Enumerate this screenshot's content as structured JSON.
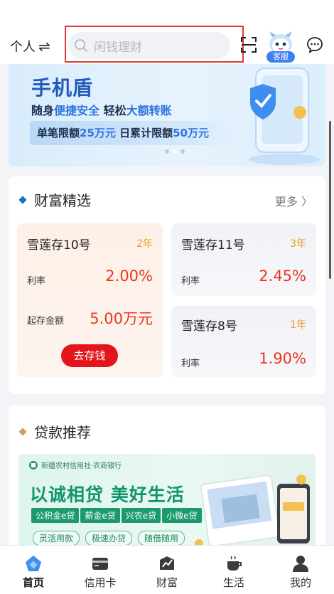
{
  "header": {
    "persona_label": "个人",
    "swap_glyph": "⇌",
    "search_placeholder": "闲钱理财",
    "service_badge": "客服"
  },
  "banner": {
    "title": "手机盾",
    "subtitle_part1": "随身",
    "subtitle_hl1": "便捷安全",
    "subtitle_part2": " 轻松",
    "subtitle_hl2": "大额转账",
    "limit_part1": "单笔限额",
    "limit_num1": "25万元",
    "limit_part2": " 日累计限额",
    "limit_num2": "50万元"
  },
  "wealth": {
    "title": "财富精选",
    "more": "更多 〉",
    "accent": "#1a6fc9",
    "featured": {
      "name": "雪莲存10号",
      "term": "2年",
      "rate_label": "利率",
      "rate": "2.00%",
      "min_label": "起存金额",
      "min_amount": "5.00万元",
      "cta": "去存钱"
    },
    "products": [
      {
        "name": "雪莲存11号",
        "term": "3年",
        "rate_label": "利率",
        "rate": "2.45%"
      },
      {
        "name": "雪莲存8号",
        "term": "1年",
        "rate_label": "利率",
        "rate": "1.90%"
      }
    ]
  },
  "loans": {
    "title": "贷款推荐",
    "accent": "#c9a25a",
    "banner_brand": "新疆农村信用社·农商银行",
    "banner_title": "以诚相贷 美好生活",
    "products": [
      "公积金e贷",
      "薪金e贷",
      "兴农e贷",
      "小微e贷"
    ],
    "tags": [
      "灵活用款",
      "极速办贷",
      "随借随用"
    ]
  },
  "tabs": [
    {
      "label": "首页",
      "icon": "home-icon",
      "active": true
    },
    {
      "label": "信用卡",
      "icon": "credit-card-icon",
      "active": false
    },
    {
      "label": "财富",
      "icon": "wealth-icon",
      "active": false
    },
    {
      "label": "生活",
      "icon": "coffee-icon",
      "active": false
    },
    {
      "label": "我的",
      "icon": "person-icon",
      "active": false
    }
  ]
}
